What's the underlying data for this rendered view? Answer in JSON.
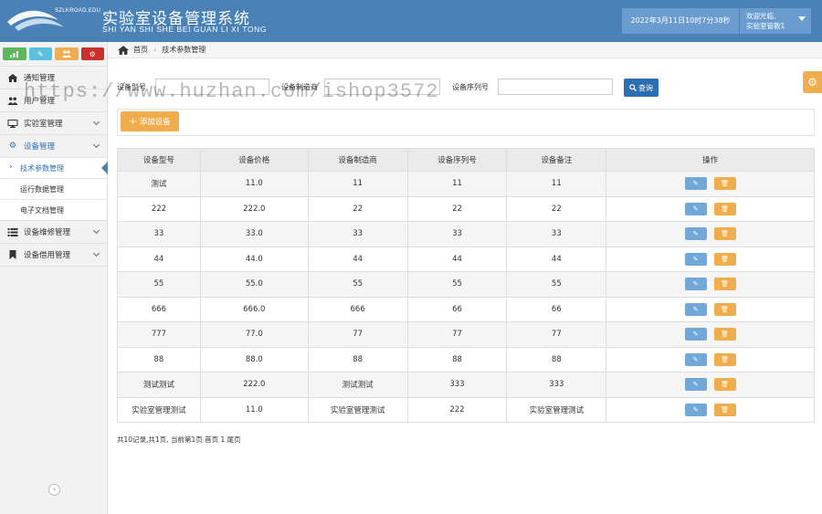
{
  "header": {
    "logo_text": "SZLKROAD.EDU",
    "title": "实验室设备管理系统",
    "subtitle": "SHI YAN SHI SHE BEI GUAN LI XI TONG",
    "datetime": "2022年3月11日10时7分38秒",
    "welcome": "欢迎光临,",
    "username": "实验室管教1"
  },
  "colors": {
    "header_bg": "#4a82b8",
    "primary": "#2b6fb3",
    "warning": "#f0ad4e",
    "edit_btn": "#72a8d8"
  },
  "shortcuts": [
    {
      "icon": "bar-chart-icon",
      "color": "#5cb85c"
    },
    {
      "icon": "pencil-icon",
      "color": "#5bc0de"
    },
    {
      "icon": "users-icon",
      "color": "#f0ad4e"
    },
    {
      "icon": "cogs-icon",
      "color": "#c9302c"
    }
  ],
  "sidebar": {
    "items": [
      {
        "label": "通知管理",
        "icon": "home-icon"
      },
      {
        "label": "用户管理",
        "icon": "users-icon"
      },
      {
        "label": "实验室管理",
        "icon": "desktop-icon"
      },
      {
        "label": "设备管理",
        "icon": "cogs-icon"
      },
      {
        "label": "设备维修管理",
        "icon": "list-icon"
      },
      {
        "label": "设备借用管理",
        "icon": "bookmark-icon"
      }
    ],
    "submenu": [
      {
        "label": "技术参数管理"
      },
      {
        "label": "运行数据管理"
      },
      {
        "label": "电子文档管理"
      }
    ],
    "collapse_icon": "double-chevron-left-icon"
  },
  "breadcrumb": {
    "home": "首页",
    "current": "技术参数管理"
  },
  "search": {
    "model_label": "设备型号",
    "maker_label": "设备制造商",
    "serial_label": "设备序列号",
    "model_value": "",
    "maker_value": "",
    "serial_value": "",
    "query_label": "查询"
  },
  "actions": {
    "add_label": "添加设备"
  },
  "table": {
    "columns": [
      "设备型号",
      "设备价格",
      "设备制造商",
      "设备序列号",
      "设备备注",
      "操作"
    ],
    "rows": [
      [
        "测试",
        "11.0",
        "11",
        "11",
        "11"
      ],
      [
        "222",
        "222.0",
        "22",
        "22",
        "22"
      ],
      [
        "33",
        "33.0",
        "33",
        "33",
        "33"
      ],
      [
        "44",
        "44.0",
        "44",
        "44",
        "44"
      ],
      [
        "55",
        "55.0",
        "55",
        "55",
        "55"
      ],
      [
        "666",
        "666.0",
        "666",
        "66",
        "66"
      ],
      [
        "777",
        "77.0",
        "77",
        "77",
        "77"
      ],
      [
        "88",
        "88.0",
        "88",
        "88",
        "88"
      ],
      [
        "测试测试",
        "222.0",
        "测试测试",
        "333",
        "333"
      ],
      [
        "实验室管理测试",
        "11.0",
        "实验室管理测试",
        "222",
        "实验室管理测试"
      ]
    ]
  },
  "pager": {
    "text": "共10记录,共1页, 当前第1页 首页 1 尾页"
  },
  "watermark": "https://www.huzhan.com/ishop3572"
}
